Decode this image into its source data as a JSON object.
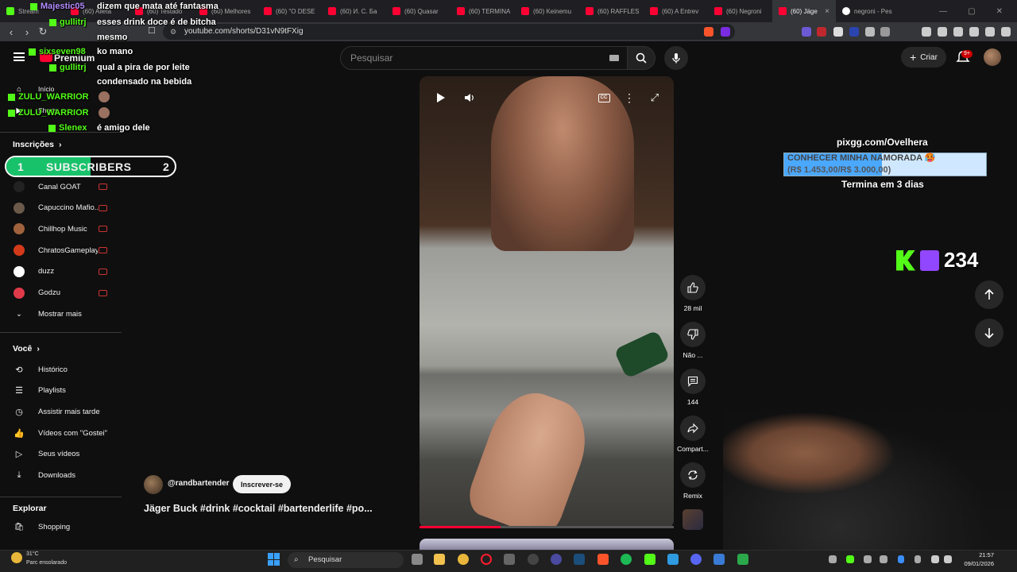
{
  "browser": {
    "tabs": [
      {
        "label": "Stream"
      },
      {
        "label": "(60) Alleta"
      },
      {
        "label": "(60) Testado"
      },
      {
        "label": "(60) Melhores"
      },
      {
        "label": "(60) \"O DESE"
      },
      {
        "label": "(60) И. С. Ба"
      },
      {
        "label": "(60) Quasar"
      },
      {
        "label": "(60) TERMINA"
      },
      {
        "label": "(60) Keinemu"
      },
      {
        "label": "(60) RAFFLES"
      },
      {
        "label": "(60) A Entrev"
      },
      {
        "label": "(60) Negroni"
      },
      {
        "label": "(60) Jäge"
      },
      {
        "label": "negroni - Pes"
      }
    ],
    "url": "youtube.com/shorts/D31vN9tFXig"
  },
  "header": {
    "search_placeholder": "Pesquisar",
    "create_label": "Criar",
    "notifications_badge": "9+"
  },
  "sidebar": {
    "home_label": "Início",
    "shorts_label": "Shorts",
    "premium_label": "Premium",
    "subscriptions_title": "Inscrições",
    "channels": [
      {
        "label": "Canal GOAT",
        "color": "#222222"
      },
      {
        "label": "Capuccino Mafio...",
        "color": "#6b5a4a"
      },
      {
        "label": "Chillhop Music",
        "color": "#a0623c"
      },
      {
        "label": "ChratosGameplay",
        "color": "#d23a1a"
      },
      {
        "label": "duzz",
        "color": "#ffffff"
      },
      {
        "label": "Godzu",
        "color": "#e03a4a"
      }
    ],
    "show_more": "Mostrar mais",
    "you_title": "Você",
    "you_items": [
      {
        "label": "Histórico"
      },
      {
        "label": "Playlists"
      },
      {
        "label": "Assistir mais tarde"
      },
      {
        "label": "Vídeos com \"Gostei\""
      },
      {
        "label": "Seus vídeos"
      },
      {
        "label": "Downloads"
      }
    ],
    "explore_title": "Explorar",
    "explore_items": [
      {
        "label": "Shopping"
      }
    ]
  },
  "chat": [
    {
      "user": "Majestic05",
      "text": "dizem que mata até fantasma",
      "color": "purple"
    },
    {
      "user": "gullitrj",
      "text": "esses drink doce é de bitcha",
      "color": "green"
    },
    {
      "user": "",
      "text": "mesmo",
      "color": ""
    },
    {
      "user": "sixseven98",
      "text": "ko mano",
      "color": "green"
    },
    {
      "user": "gullitrj",
      "text": "qual a pira de por leite",
      "color": "green"
    },
    {
      "user": "",
      "text": "condensado na bebida",
      "color": ""
    },
    {
      "user": "ZULU_WARRIOR",
      "text": "",
      "color": "green"
    },
    {
      "user": "ZULU_WARRIOR",
      "text": "",
      "color": "green"
    },
    {
      "user": "Slenex",
      "text": "é amigo dele",
      "color": "green"
    }
  ],
  "subscribers_bar": {
    "left": "1",
    "label": "SUBSCRIBERS",
    "right": "2",
    "progress": 0.5
  },
  "video": {
    "channel": "@randbartender",
    "subscribe_label": "Inscrever-se",
    "title": "Jäger Buck #drink #cocktail #bartenderlife #po...",
    "progress": 0.32
  },
  "actions": {
    "like_count": "28 mil",
    "dislike_label": "Não ...",
    "comments_count": "144",
    "share_label": "Compart...",
    "remix_label": "Remix"
  },
  "stream_overlay": {
    "pix_url": "pixgg.com/Ovelhera",
    "goal_title": "CONHECER MINHA NAMORADA 🥵",
    "goal_amount": "(R$ 1.453,00/R$ 3.000,00)",
    "goal_progress": 0.484,
    "goal_ends": "Termina em 3 dias",
    "viewers": "234"
  },
  "taskbar": {
    "weather_temp": "31°C",
    "weather_desc": "Parc ensolarado",
    "search_label": "Pesquisar",
    "time": "21:57",
    "date": "09/01/2026"
  },
  "colors": {
    "accent_red": "#ff0033",
    "kick_green": "#53fc18",
    "twitch_purple": "#9146ff"
  }
}
